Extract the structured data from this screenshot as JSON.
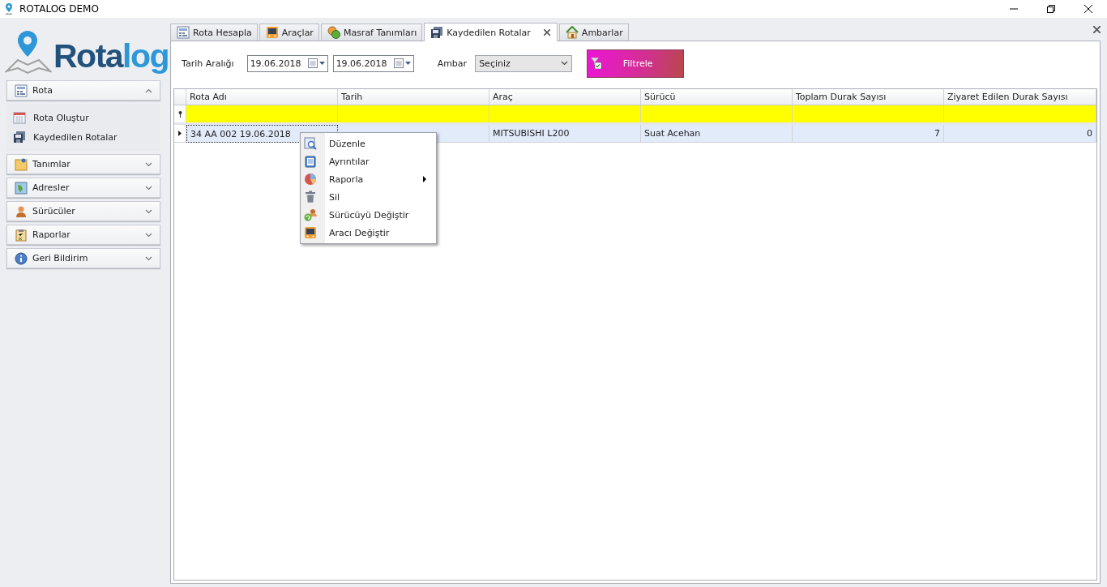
{
  "window": {
    "title": "ROTALOG DEMO"
  },
  "logo": {
    "text_dark": "Rota",
    "text_light": "log"
  },
  "sidebar": {
    "groups": [
      {
        "label": "Rota",
        "expanded": true,
        "items": [
          {
            "label": "Rota Oluştur"
          },
          {
            "label": "Kaydedilen Rotalar"
          }
        ]
      },
      {
        "label": "Tanımlar",
        "expanded": false
      },
      {
        "label": "Adresler",
        "expanded": false
      },
      {
        "label": "Sürücüler",
        "expanded": false
      },
      {
        "label": "Raporlar",
        "expanded": false
      },
      {
        "label": "Geri Bildirim",
        "expanded": false
      }
    ]
  },
  "tabs": [
    {
      "label": "Rota Hesapla",
      "selected": false
    },
    {
      "label": "Araçlar",
      "selected": false
    },
    {
      "label": "Masraf Tanımları",
      "selected": false
    },
    {
      "label": "Kaydedilen Rotalar",
      "selected": true
    },
    {
      "label": "Ambarlar",
      "selected": false
    }
  ],
  "filter": {
    "date_label": "Tarih Aralığı",
    "date_from": "19.06.2018",
    "date_to": "19.06.2018",
    "warehouse_label": "Ambar",
    "warehouse_value": "Seçiniz",
    "button": "Filtrele"
  },
  "table": {
    "columns": [
      "Rota Adı",
      "Tarih",
      "Araç",
      "Sürücü",
      "Toplam Durak Sayısı",
      "Ziyaret Edilen Durak Sayısı"
    ],
    "rows": [
      {
        "selected": true,
        "cells": [
          "34 AA 002 19.06.2018",
          null,
          "MITSUBISHI L200",
          "Suat Acehan",
          "7",
          "0"
        ]
      }
    ]
  },
  "context_menu": {
    "items": [
      {
        "label": "Düzenle",
        "submenu": false
      },
      {
        "label": "Ayrıntılar",
        "submenu": false
      },
      {
        "label": "Raporla",
        "submenu": true
      },
      {
        "label": "Sil",
        "submenu": false
      },
      {
        "label": "Sürücüyü Değiştir",
        "submenu": false
      },
      {
        "label": "Aracı Değiştir",
        "submenu": false
      }
    ]
  }
}
